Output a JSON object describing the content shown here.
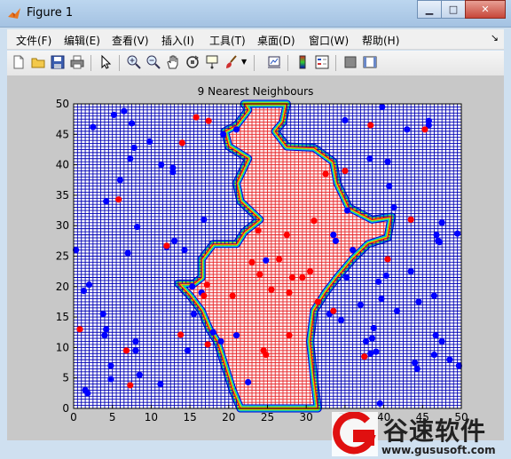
{
  "window": {
    "title": "Figure 1"
  },
  "menus": [
    "文件(F)",
    "编辑(E)",
    "查看(V)",
    "插入(I)",
    "工具(T)",
    "桌面(D)",
    "窗口(W)",
    "帮助(H)"
  ],
  "toolbar_icons": [
    "new-file-icon",
    "open-folder-icon",
    "save-icon",
    "print-icon",
    "pointer-icon",
    "zoom-in-icon",
    "zoom-out-icon",
    "pan-hand-icon",
    "rotate-3d-icon",
    "data-cursor-icon",
    "brush-icon",
    "link-plot-icon",
    "colorbar-icon",
    "legend-icon",
    "hide-plot-tools-icon",
    "show-plot-tools-icon"
  ],
  "colors": {
    "class_a": "#0000ff",
    "class_b": "#ff0000",
    "grid_a": "#0000b4",
    "grid_b": "#e6282d",
    "background": "#ffffff"
  },
  "chart_data": {
    "type": "scatter",
    "title": "9 Nearest Neighbours",
    "xlim": [
      0,
      50
    ],
    "ylim": [
      0,
      50
    ],
    "xticks": [
      "0",
      "5",
      "10",
      "15",
      "20",
      "25",
      "30",
      "35",
      "40",
      "45",
      "50"
    ],
    "yticks": [
      "0",
      "5",
      "10",
      "15",
      "20",
      "25",
      "30",
      "35",
      "40",
      "45",
      "50"
    ],
    "boundary_region": [
      [
        22,
        50
      ],
      [
        27.5,
        50
      ],
      [
        27,
        47
      ],
      [
        26,
        45.5
      ],
      [
        27.5,
        43
      ],
      [
        31,
        42.8
      ],
      [
        33.5,
        40.5
      ],
      [
        34,
        37
      ],
      [
        35.5,
        33
      ],
      [
        38.5,
        31
      ],
      [
        41,
        31.5
      ],
      [
        40.5,
        28
      ],
      [
        38,
        27
      ],
      [
        36,
        24.5
      ],
      [
        34,
        21.5
      ],
      [
        32.5,
        19
      ],
      [
        31,
        16
      ],
      [
        30.5,
        11
      ],
      [
        31,
        5
      ],
      [
        31.5,
        0
      ],
      [
        21.5,
        0
      ],
      [
        20.5,
        3
      ],
      [
        19.5,
        7
      ],
      [
        18.5,
        11
      ],
      [
        17.5,
        13
      ],
      [
        16.5,
        16
      ],
      [
        15,
        18.5
      ],
      [
        13.5,
        20.5
      ],
      [
        15.5,
        20.5
      ],
      [
        16.5,
        21.5
      ],
      [
        16.5,
        24.5
      ],
      [
        18,
        27
      ],
      [
        21,
        27
      ],
      [
        22,
        29
      ],
      [
        24,
        31
      ],
      [
        21.5,
        34
      ],
      [
        21,
        37
      ],
      [
        22.5,
        41
      ],
      [
        20,
        43
      ],
      [
        19.5,
        45.5
      ],
      [
        21,
        46.5
      ],
      [
        22.5,
        49
      ]
    ],
    "series": [
      {
        "color": "blue",
        "points": [
          [
            0.3,
            26
          ],
          [
            1.3,
            19.3
          ],
          [
            1.5,
            3
          ],
          [
            1.8,
            2.5
          ],
          [
            2,
            20.3
          ],
          [
            2.5,
            46.2
          ],
          [
            3.8,
            15.5
          ],
          [
            4,
            12
          ],
          [
            4.2,
            13
          ],
          [
            4.2,
            34
          ],
          [
            4.8,
            7
          ],
          [
            4.8,
            4.8
          ],
          [
            5.2,
            48.2
          ],
          [
            6,
            37.5
          ],
          [
            6.5,
            48.8
          ],
          [
            7,
            25.5
          ],
          [
            7.3,
            41
          ],
          [
            7.5,
            46.8
          ],
          [
            7.8,
            42.8
          ],
          [
            8,
            11
          ],
          [
            8,
            9.5
          ],
          [
            8.2,
            29.8
          ],
          [
            8.5,
            5.5
          ],
          [
            9.8,
            43.8
          ],
          [
            11.2,
            4
          ],
          [
            11.3,
            40
          ],
          [
            12,
            26.5
          ],
          [
            12.8,
            39.5
          ],
          [
            12.8,
            38.8
          ],
          [
            13,
            27.5
          ],
          [
            14.3,
            26
          ],
          [
            14.7,
            9.5
          ],
          [
            15.3,
            20
          ],
          [
            15.5,
            15.5
          ],
          [
            16.5,
            19
          ],
          [
            16.8,
            31
          ],
          [
            18,
            12.5
          ],
          [
            19,
            11
          ],
          [
            19.3,
            45
          ],
          [
            21,
            45.8
          ],
          [
            21,
            12
          ],
          [
            22.5,
            4.3
          ],
          [
            24.8,
            24.3
          ],
          [
            33,
            15.5
          ],
          [
            33.5,
            28.5
          ],
          [
            33.8,
            27.5
          ],
          [
            34.5,
            14.5
          ],
          [
            35.3,
            32.5
          ],
          [
            35,
            47.3
          ],
          [
            35.2,
            21.5
          ],
          [
            36,
            26
          ],
          [
            37,
            17
          ],
          [
            37.7,
            11
          ],
          [
            38.2,
            41
          ],
          [
            38.5,
            11.5
          ],
          [
            38.3,
            9
          ],
          [
            38.7,
            13.2
          ],
          [
            39,
            9.3
          ],
          [
            39.3,
            20.8
          ],
          [
            39.5,
            0.8
          ],
          [
            39.7,
            18
          ],
          [
            39.8,
            49.5
          ],
          [
            40.3,
            21.8
          ],
          [
            40.5,
            40.5
          ],
          [
            40.7,
            36.5
          ],
          [
            41.3,
            33
          ],
          [
            41.7,
            16
          ],
          [
            43,
            45.8
          ],
          [
            43.5,
            22.5
          ],
          [
            44,
            7.5
          ],
          [
            44.3,
            6.5
          ],
          [
            44.5,
            17.5
          ],
          [
            45.8,
            46.5
          ],
          [
            45.8,
            47.2
          ],
          [
            46.5,
            18.5
          ],
          [
            46.5,
            8.8
          ],
          [
            46.7,
            12
          ],
          [
            46.8,
            28.5
          ],
          [
            47,
            27.5
          ],
          [
            47.2,
            27.3
          ],
          [
            47.5,
            30.5
          ],
          [
            47.5,
            11
          ],
          [
            48.5,
            8
          ],
          [
            49.5,
            28.7
          ],
          [
            49.7,
            7
          ]
        ]
      },
      {
        "color": "red",
        "points": [
          [
            0.8,
            13
          ],
          [
            6.8,
            9.5
          ],
          [
            5.8,
            34.3
          ],
          [
            7.3,
            3.8
          ],
          [
            12,
            26.7
          ],
          [
            13.8,
            12.1
          ],
          [
            14,
            43.6
          ],
          [
            15.8,
            47.8
          ],
          [
            16.8,
            18.5
          ],
          [
            17.2,
            20.3
          ],
          [
            17.3,
            10.5
          ],
          [
            17.4,
            47.2
          ],
          [
            20.5,
            18.5
          ],
          [
            23,
            24
          ],
          [
            23.8,
            29.2
          ],
          [
            24,
            22
          ],
          [
            24.5,
            9.5
          ],
          [
            24.8,
            8.8
          ],
          [
            25.5,
            19.5
          ],
          [
            26.5,
            24.5
          ],
          [
            27.5,
            28.5
          ],
          [
            27.8,
            19
          ],
          [
            27.8,
            12
          ],
          [
            28.2,
            21.5
          ],
          [
            29.5,
            21.5
          ],
          [
            30.5,
            22.5
          ],
          [
            31,
            30.8
          ],
          [
            31.5,
            17.5
          ],
          [
            32.5,
            38.5
          ],
          [
            33.5,
            16
          ],
          [
            35,
            39
          ],
          [
            37.5,
            8.5
          ],
          [
            38.3,
            46.5
          ],
          [
            40.5,
            24.5
          ],
          [
            43.5,
            31
          ],
          [
            45.3,
            45.8
          ]
        ]
      }
    ]
  },
  "watermark": {
    "title": "谷速软件",
    "url": "www.gususoft.com"
  }
}
